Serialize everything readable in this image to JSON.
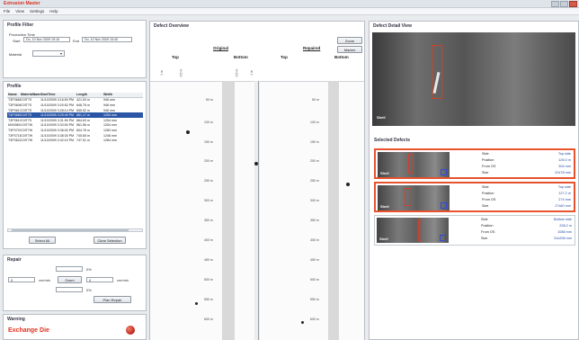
{
  "window": {
    "title": "Extrusion Master"
  },
  "menu": [
    "File",
    "View",
    "Settings",
    "Help"
  ],
  "profile_filter": {
    "title": "Profile Filter",
    "production_time_label": "Production Time",
    "start_label": "Start",
    "start_value": "Do, 10 Nov 2009 15:16",
    "end_label": "End",
    "end_value": "Do, 10 Nov 2009 15:40",
    "material_label": "Material"
  },
  "profile": {
    "title": "Profile",
    "columns": [
      "Name",
      "MaterialName",
      "StartTime",
      "Length",
      "Width"
    ],
    "rows": [
      [
        "T3FS661",
        "C0IT7S",
        "11/10/2009 3:16:50 PM",
        "421.53 m",
        "946 mm"
      ],
      [
        "T3FS606",
        "C0IT7S",
        "11/10/2009 3:20:52 PM",
        "648.76 m",
        "946 mm"
      ],
      [
        "T3FS617",
        "C0IT7S",
        "11/10/2009 3:28:14 PM",
        "655.52 m",
        "946 mm"
      ],
      [
        "T3FS669",
        "C0IT7S",
        "11/10/2009 3:29:49 PM",
        "661.17 m",
        "1254 mm"
      ],
      [
        "T3FS619",
        "C0IT7S",
        "11/10/2009 3:31:50 PM",
        "664.63 m",
        "1254 mm"
      ],
      [
        "MX00894",
        "C0IT7W",
        "11/10/2009 3:33:50 PM",
        "561.56 m",
        "1254 mm"
      ],
      [
        "T3FS707",
        "C0IT7W",
        "11/10/2009 3:36:00 PM",
        "604.76 m",
        "1283 mm"
      ],
      [
        "T3FS716",
        "C0IT7W",
        "11/10/2009 3:38:30 PM",
        "745.65 m",
        "1246 mm"
      ],
      [
        "T3FS622",
        "C0IT7W",
        "11/10/2009 3:42:10 PM",
        "747.51 m",
        "1284 mm"
      ]
    ],
    "selected_index": 3,
    "select_all": "Select All",
    "clear_selection": "Clear Selection"
  },
  "repair": {
    "title": "Repair",
    "pct1": "0%",
    "val_left": "0",
    "unit_left": "cm/min",
    "zoom_btn": "Zoom",
    "val_right": "0",
    "unit_right": "cm/min",
    "pct2": "0%",
    "btn_repair": "Plan Repair"
  },
  "warning": {
    "title": "Warning",
    "message": "Exchange Die"
  },
  "overview": {
    "title": "Defect Overview",
    "button_1": "Zoom",
    "button_2": "Marker",
    "group_original": "Original",
    "group_repaired": "Repaired",
    "top": "Top",
    "bottom": "Bottom",
    "col_axis": [
      "1 m",
      "0.5 m"
    ],
    "ticks": [
      "50 m",
      "100 m",
      "150 m",
      "200 m",
      "250 m",
      "300 m",
      "350 m",
      "400 m",
      "450 m",
      "500 m",
      "550 m",
      "600 m"
    ]
  },
  "detail": {
    "title": "Defect Detail View",
    "image_label": "Shell"
  },
  "selected_defects": {
    "title": "Selected Defects",
    "labels": [
      "Side",
      "Position",
      "From OS",
      "Size"
    ],
    "items": [
      {
        "image_label": "Shell",
        "side": "Top side",
        "position": "126.0 m",
        "from_os": "304 mm",
        "size": "22x78 mm"
      },
      {
        "image_label": "Shell",
        "side": "Top side",
        "position": "127.2 m",
        "from_os": "274 mm",
        "size": "27x60 mm"
      },
      {
        "image_label": "Shell",
        "side": "Bottom side",
        "position": "208.2 m",
        "from_os": "1088 mm",
        "size": "31x208 mm"
      }
    ]
  },
  "colors": {
    "accent": "#e8532e",
    "selection": "#2b56a6",
    "warning": "#e0321e"
  }
}
